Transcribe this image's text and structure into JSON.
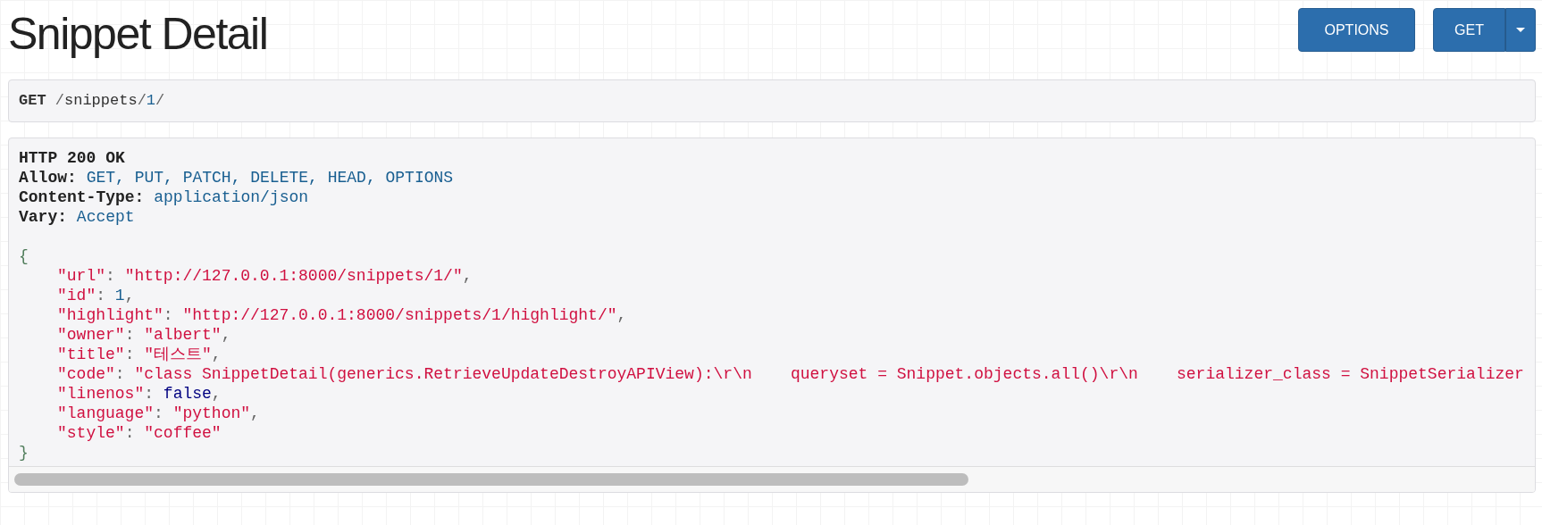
{
  "page": {
    "title": "Snippet Detail"
  },
  "buttons": [
    {
      "label": "OPTIONS",
      "kind": "plain"
    },
    {
      "label": "GET",
      "kind": "split"
    }
  ],
  "request": {
    "method": "GET",
    "path": [
      {
        "text": "/",
        "kind": "punct"
      },
      {
        "text": "snippets",
        "kind": "name"
      },
      {
        "text": "/",
        "kind": "punct"
      },
      {
        "text": "1",
        "kind": "number"
      },
      {
        "text": "/",
        "kind": "punct"
      }
    ]
  },
  "response": {
    "status": "HTTP 200 OK",
    "headers": [
      {
        "name": "Allow:",
        "value": "GET, PUT, PATCH, DELETE, HEAD, OPTIONS"
      },
      {
        "name": "Content-Type:",
        "value": "application/json"
      },
      {
        "name": "Vary:",
        "value": "Accept"
      }
    ],
    "body": {
      "open": "{",
      "close": "}",
      "members": [
        {
          "tokens": [
            {
              "text": "\"url\"",
              "kind": "key"
            },
            {
              "text": ": ",
              "kind": "punct"
            },
            {
              "text": "\"http://127.0.0.1:8000/snippets/1/\"",
              "kind": "string"
            },
            {
              "text": ",",
              "kind": "punct"
            }
          ]
        },
        {
          "tokens": [
            {
              "text": "\"id\"",
              "kind": "key"
            },
            {
              "text": ": ",
              "kind": "punct"
            },
            {
              "text": "1",
              "kind": "number"
            },
            {
              "text": ",",
              "kind": "punct"
            }
          ]
        },
        {
          "tokens": [
            {
              "text": "\"highlight\"",
              "kind": "key"
            },
            {
              "text": ": ",
              "kind": "punct"
            },
            {
              "text": "\"http://127.0.0.1:8000/snippets/1/highlight/\"",
              "kind": "string"
            },
            {
              "text": ",",
              "kind": "punct"
            }
          ]
        },
        {
          "tokens": [
            {
              "text": "\"owner\"",
              "kind": "key"
            },
            {
              "text": ": ",
              "kind": "punct"
            },
            {
              "text": "\"albert\"",
              "kind": "string"
            },
            {
              "text": ",",
              "kind": "punct"
            }
          ]
        },
        {
          "tokens": [
            {
              "text": "\"title\"",
              "kind": "key"
            },
            {
              "text": ": ",
              "kind": "punct"
            },
            {
              "text": "\"테스트\"",
              "kind": "string"
            },
            {
              "text": ",",
              "kind": "punct"
            }
          ]
        },
        {
          "tokens": [
            {
              "text": "\"code\"",
              "kind": "key"
            },
            {
              "text": ": ",
              "kind": "punct"
            },
            {
              "text": "\"class SnippetDetail(generics.RetrieveUpdateDestroyAPIView):\\r\\n    queryset = Snippet.objects.all()\\r\\n    serializer_class = SnippetSerializer",
              "kind": "string"
            }
          ]
        },
        {
          "tokens": [
            {
              "text": "\"linenos\"",
              "kind": "key"
            },
            {
              "text": ": ",
              "kind": "punct"
            },
            {
              "text": "false",
              "kind": "literal"
            },
            {
              "text": ",",
              "kind": "punct"
            }
          ]
        },
        {
          "tokens": [
            {
              "text": "\"language\"",
              "kind": "key"
            },
            {
              "text": ": ",
              "kind": "punct"
            },
            {
              "text": "\"python\"",
              "kind": "string"
            },
            {
              "text": ",",
              "kind": "punct"
            }
          ]
        },
        {
          "tokens": [
            {
              "text": "\"style\"",
              "kind": "key"
            },
            {
              "text": ": ",
              "kind": "punct"
            },
            {
              "text": "\"coffee\"",
              "kind": "string"
            }
          ]
        }
      ]
    }
  }
}
